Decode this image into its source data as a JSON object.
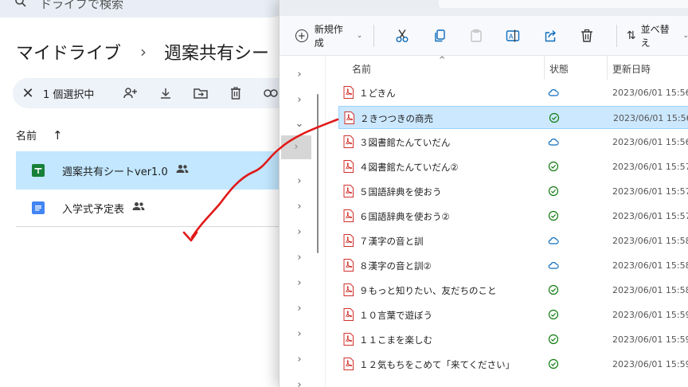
{
  "drive": {
    "search_placeholder": "ドライブで検索",
    "breadcrumb": [
      "マイドライブ",
      "週案共有シー"
    ],
    "breadcrumb_separator": "›",
    "selection": {
      "close_glyph": "✕",
      "count_label": "1 個選択中"
    },
    "column_name": "名前",
    "sort_arrow": "↑",
    "files": [
      {
        "name": "週案共有シートver1.0",
        "type": "google-sheets",
        "color": "#188038",
        "selected": true,
        "shared": true
      },
      {
        "name": "入学式予定表",
        "type": "google-docs",
        "color": "#4285f4",
        "selected": false,
        "shared": true
      }
    ]
  },
  "explorer": {
    "toolbar": {
      "new_label": "新規作成",
      "sort_label": "並べ替え",
      "tools": [
        "cut-icon",
        "copy-icon",
        "paste-icon",
        "rename-icon",
        "share-icon",
        "delete-icon"
      ]
    },
    "headers": {
      "name": "名前",
      "status": "状態",
      "modified": "更新日時"
    },
    "files": [
      {
        "name": "１どきん",
        "status": "cloud",
        "modified": "2023/06/01 15:56"
      },
      {
        "name": "２きつつきの商売",
        "status": "synced",
        "modified": "2023/06/01 15:56",
        "selected": true
      },
      {
        "name": "３図書館たんていだん",
        "status": "cloud",
        "modified": "2023/06/01 15:56"
      },
      {
        "name": "４図書館たんていだん②",
        "status": "synced",
        "modified": "2023/06/01 15:57"
      },
      {
        "name": "５国語辞典を使おう",
        "status": "synced",
        "modified": "2023/06/01 15:57"
      },
      {
        "name": "６国語辞典を使おう②",
        "status": "synced",
        "modified": "2023/06/01 15:57"
      },
      {
        "name": "７漢字の音と訓",
        "status": "cloud",
        "modified": "2023/06/01 15:58"
      },
      {
        "name": "８漢字の音と訓②",
        "status": "cloud",
        "modified": "2023/06/01 15:58"
      },
      {
        "name": "９もっと知りたい、友だちのこと",
        "status": "synced",
        "modified": "2023/06/01 15:58"
      },
      {
        "name": "１０言葉で遊ぼう",
        "status": "synced",
        "modified": "2023/06/01 15:59"
      },
      {
        "name": "１１こまを楽しむ",
        "status": "synced",
        "modified": "2023/06/01 15:59"
      },
      {
        "name": "１２気もちをこめて「来てください」",
        "status": "synced",
        "modified": "2023/06/01 15:59"
      }
    ],
    "nav_items": [
      "expand",
      "expand",
      "collapse",
      "expand-hover",
      "expand",
      "expand",
      "expand",
      "expand",
      "expand",
      "expand",
      "expand",
      "expand",
      "expand"
    ]
  },
  "colors": {
    "accent_blue": "#0b57d0",
    "selection_drive": "#c2e7ff",
    "selection_explorer": "#cce8ff",
    "synced_green": "#107c10",
    "cloud_blue": "#0f6cbd",
    "pdf_red": "#d0312d",
    "drag_arrow": "#e11919"
  }
}
